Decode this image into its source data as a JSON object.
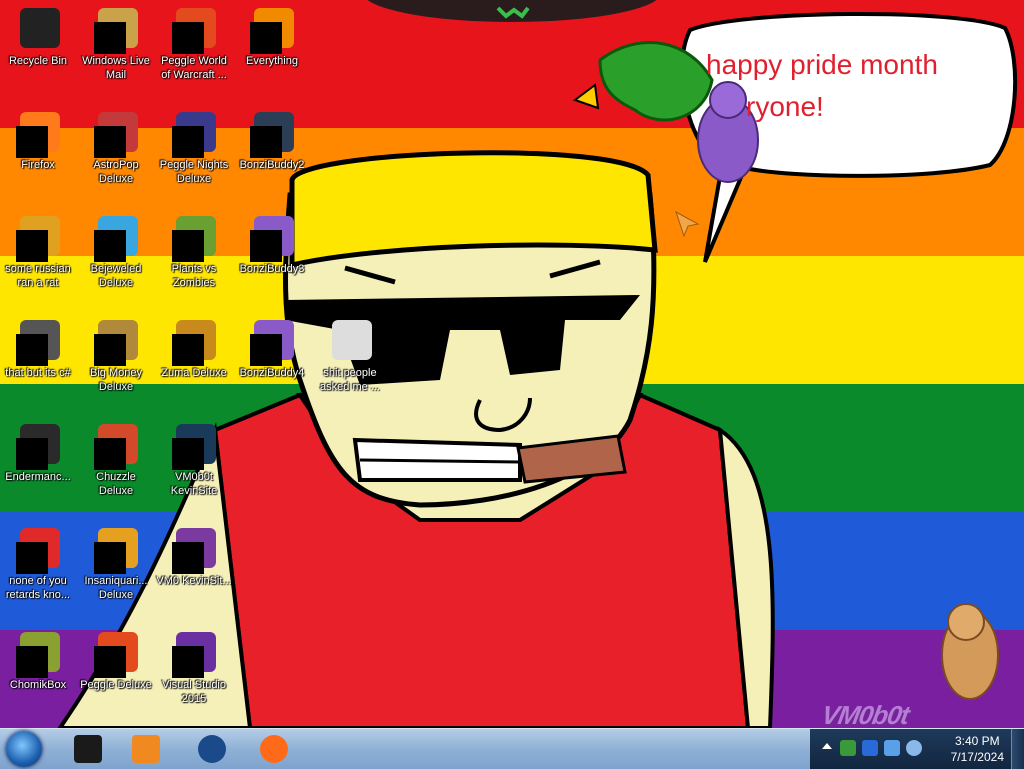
{
  "wallpaper": {
    "stripe_colors": [
      "#e8141c",
      "#ff8800",
      "#ffe600",
      "#0a8a2a",
      "#1f5bd8",
      "#7a1fa0"
    ],
    "speech_bubble_text_line1": "happy pride month",
    "speech_bubble_text_line2": "ryone!",
    "corner_logo": "VM0b0t"
  },
  "desktop_icons": [
    {
      "label": "Recycle Bin",
      "icon": "recycle-bin-icon",
      "color": "#222222"
    },
    {
      "label": "Windows Live Mail",
      "icon": "mail-icon",
      "color": "#c9a24a"
    },
    {
      "label": "Peggle World of Warcraft ...",
      "icon": "peggle-icon",
      "color": "#e34b1f"
    },
    {
      "label": "Everything",
      "icon": "everything-icon",
      "color": "#f28a00"
    },
    {
      "label": "Firefox",
      "icon": "firefox-icon",
      "color": "#ff7a1a"
    },
    {
      "label": "AstroPop Deluxe",
      "icon": "astropop-icon",
      "color": "#c43a3a"
    },
    {
      "label": "Peggle Nights Deluxe",
      "icon": "peggle-nights-icon",
      "color": "#3a3a8c"
    },
    {
      "label": "BonziBuddy2",
      "icon": "folder-icon",
      "color": "#2b3e55"
    },
    {
      "label": "some russian ran a rat",
      "icon": "rat-icon",
      "color": "#e0a020"
    },
    {
      "label": "Bejeweled Deluxe",
      "icon": "bejeweled-icon",
      "color": "#3aa6e0"
    },
    {
      "label": "Plants vs Zombies",
      "icon": "pvz-icon",
      "color": "#6aa032"
    },
    {
      "label": "BonziBuddy3",
      "icon": "bonzi-icon",
      "color": "#8a5ac8"
    },
    {
      "label": "that but its c#",
      "icon": "stack-icon",
      "color": "#555555"
    },
    {
      "label": "Big Money Deluxe",
      "icon": "money-icon",
      "color": "#b08a3a"
    },
    {
      "label": "Zuma Deluxe",
      "icon": "zuma-icon",
      "color": "#c88a1a"
    },
    {
      "label": "BonziBuddy4",
      "icon": "bonzi-icon",
      "color": "#8a5ac8"
    },
    {
      "label": "shit people asked me ...",
      "icon": "file-icon",
      "color": "#dddddd"
    },
    {
      "label": "Endermanc...",
      "icon": "terminal-icon",
      "color": "#2a2a2a"
    },
    {
      "label": "Chuzzle Deluxe",
      "icon": "chuzzle-icon",
      "color": "#d24a2a"
    },
    {
      "label": "VM0b0t KevinSite",
      "icon": "site-icon",
      "color": "#1a3a5a"
    },
    {
      "label": "none of you retards kno...",
      "icon": "chrome-icon",
      "color": "#e02a2a"
    },
    {
      "label": "Insaniquari... Deluxe",
      "icon": "fish-icon",
      "color": "#e6a020"
    },
    {
      "label": "VM0 KevinSit...",
      "icon": "document-icon",
      "color": "#7a3aa0"
    },
    {
      "label": "ChomikBox",
      "icon": "chomikbox-icon",
      "color": "#8aa030"
    },
    {
      "label": "Peggle Deluxe",
      "icon": "peggle-icon",
      "color": "#e34b1f"
    },
    {
      "label": "Visual Studio 2015",
      "icon": "visual-studio-icon",
      "color": "#6a2fa0"
    }
  ],
  "taskbar": {
    "pinned": [
      {
        "name": "explorer-button",
        "icon": "folder-icon",
        "color": "#1a1a1a"
      },
      {
        "name": "media-player-button",
        "icon": "media-player-icon",
        "color": "#f08a20"
      },
      {
        "name": "internet-button",
        "icon": "globe-icon",
        "color": "#1a4a8a"
      },
      {
        "name": "firefox-button",
        "icon": "firefox-icon",
        "color": "#ff6a1a"
      }
    ],
    "clock_time": "3:40 PM",
    "clock_date": "7/17/2024"
  }
}
